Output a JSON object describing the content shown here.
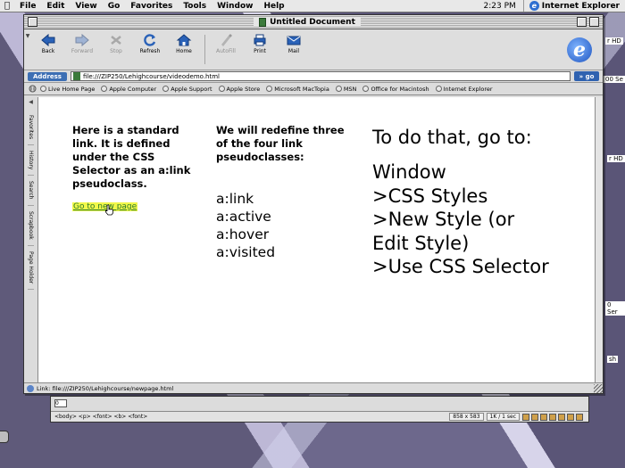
{
  "menubar": {
    "items": [
      "File",
      "Edit",
      "View",
      "Go",
      "Favorites",
      "Tools",
      "Window",
      "Help"
    ],
    "clock": "2:23 PM",
    "app_name": "Internet Explorer"
  },
  "window": {
    "title": "Untitled Document"
  },
  "toolbar": {
    "buttons": [
      {
        "label": "Back",
        "icon": "back-arrow-icon",
        "enabled": true
      },
      {
        "label": "Forward",
        "icon": "forward-arrow-icon",
        "enabled": false
      },
      {
        "label": "Stop",
        "icon": "stop-icon",
        "enabled": false
      },
      {
        "label": "Refresh",
        "icon": "refresh-icon",
        "enabled": true
      },
      {
        "label": "Home",
        "icon": "home-icon",
        "enabled": true
      },
      {
        "label": "AutoFill",
        "icon": "autofill-icon",
        "enabled": false
      },
      {
        "label": "Print",
        "icon": "print-icon",
        "enabled": true
      },
      {
        "label": "Mail",
        "icon": "mail-icon",
        "enabled": true
      }
    ]
  },
  "address": {
    "label": "Address",
    "url": "file:///ZIP250/Lehighcourse/videodemo.html",
    "go_label": "go"
  },
  "favorites": [
    "Live Home Page",
    "Apple Computer",
    "Apple Support",
    "Apple Store",
    "Microsoft MacTopia",
    "MSN",
    "Office for Macintosh",
    "Internet Explorer"
  ],
  "explorer_tabs": [
    "Favorites",
    "History",
    "Search",
    "Scrapbook",
    "Page Holder"
  ],
  "page": {
    "intro": "Here is a standard link. It is defined under the CSS Selector as an a:link pseudoclass.",
    "link_text": "Go to new page",
    "redefine": "We will redefine three of the four link pseudoclasses:",
    "pseudoclasses": [
      "a:link",
      "a:active",
      "a:hover",
      "a:visited"
    ],
    "howto_heading": "To do that, go to:",
    "steps": [
      "Window",
      ">CSS Styles",
      ">New Style (or",
      "Edit Style)",
      ">Use CSS Selector"
    ]
  },
  "status": {
    "text": "Link: file:///ZIP250/Lehighcourse/newpage.html"
  },
  "dreamweaver": {
    "field_value": "0",
    "tag_path": "<body> <p> <font> <b> <font>",
    "size": "858 x 583",
    "download": "1K / 1 sec"
  },
  "desktop_labels": [
    "r HD",
    "00 Se",
    "r HD",
    "0 Ser",
    "sh"
  ]
}
